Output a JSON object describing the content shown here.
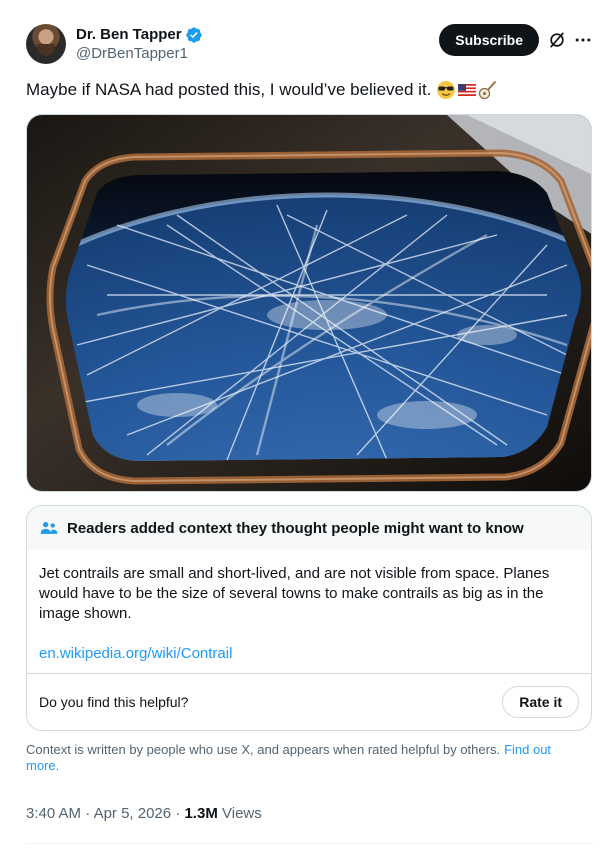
{
  "author": {
    "display_name": "Dr. Ben Tapper",
    "handle": "@DrBenTapper1",
    "verified_icon": "verified-badge-icon"
  },
  "header": {
    "subscribe_label": "Subscribe",
    "grok_icon": "grok-icon",
    "more_icon": "more-icon"
  },
  "tweet": {
    "text": "Maybe if NASA had posted this, I would’ve believed it.",
    "emojis": [
      "sunglasses-emoji",
      "us-flag-emoji",
      "banjo-emoji"
    ]
  },
  "media": {
    "kind": "photo"
  },
  "community_note": {
    "title": "Readers added context they thought people might want to know",
    "body": "Jet contrails are small and short-lived, and are not visible from space. Planes would have to be the size of several towns to make contrails as big as in the image shown.",
    "link": "en.wikipedia.org/wiki/Contrail",
    "helpful_prompt": "Do you find this helpful?",
    "rate_label": "Rate it"
  },
  "context_note": {
    "text": "Context is written by people who use X, and appears when rated helpful by others.",
    "link": "Find out more."
  },
  "meta": {
    "time": "3:40 AM",
    "date": "Apr 5, 2026",
    "views_count": "1.3M",
    "views_label": "Views"
  },
  "colors": {
    "accent": "#1d9bf0",
    "text": "#0f1419",
    "secondary": "#536471"
  }
}
